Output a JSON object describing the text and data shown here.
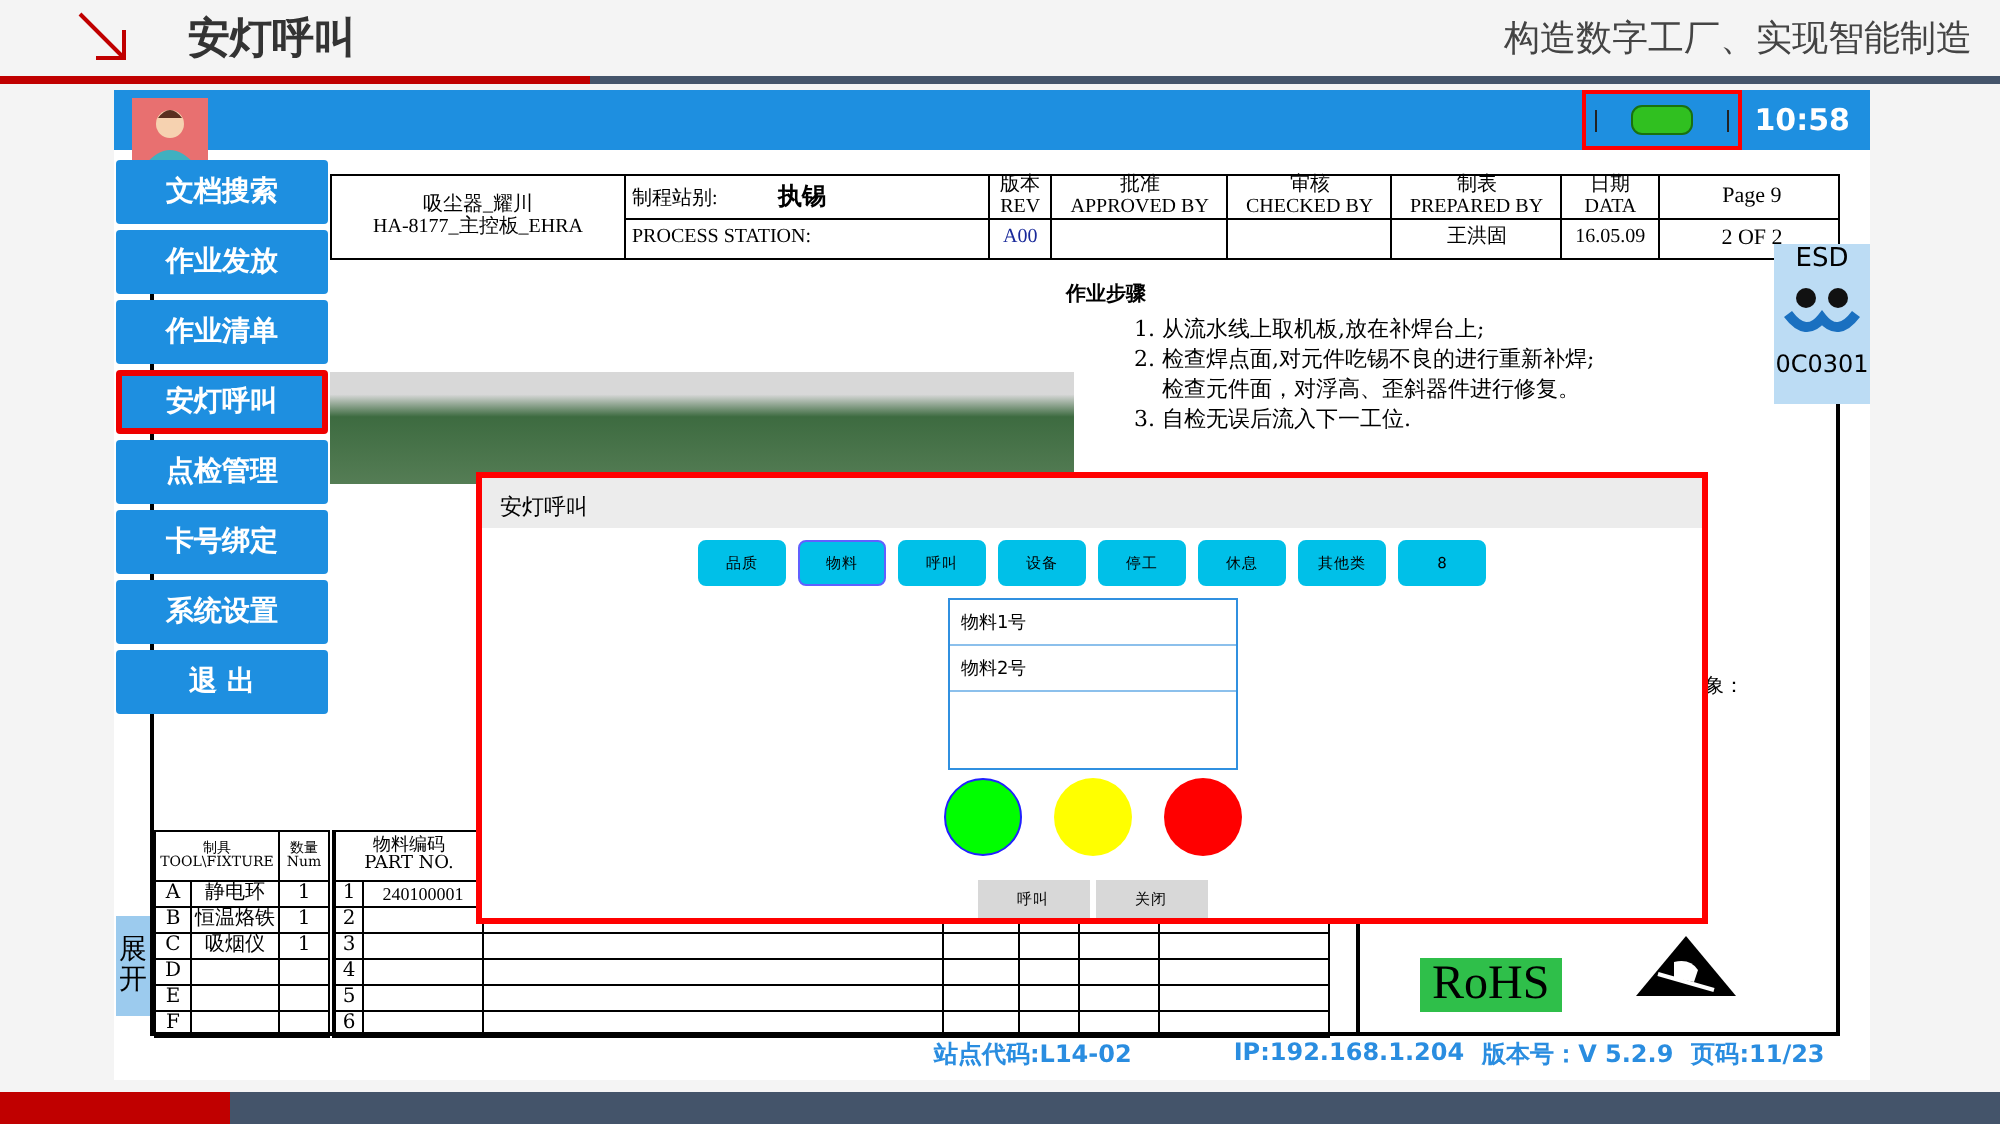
{
  "slide": {
    "title": "安灯呼叫",
    "slogan": "构造数字工厂、实现智能制造"
  },
  "top_bar": {
    "time": "10:58"
  },
  "menu": [
    {
      "label": "文档搜索",
      "selected": false
    },
    {
      "label": "作业发放",
      "selected": false
    },
    {
      "label": "作业清单",
      "selected": false
    },
    {
      "label": "安灯呼叫",
      "selected": true
    },
    {
      "label": "点检管理",
      "selected": false
    },
    {
      "label": "卡号绑定",
      "selected": false
    },
    {
      "label": "系统设置",
      "selected": false
    },
    {
      "label": "退 出",
      "selected": false
    }
  ],
  "sop_header": {
    "product": "吸尘器_耀川",
    "board": "HA-8177_主控板_EHRA",
    "station_label": "制程站别:",
    "station": "执锡",
    "station_label_en": "PROCESS STATION:",
    "columns": [
      {
        "cn": "版本",
        "en": "REV",
        "value": "A00"
      },
      {
        "cn": "批准",
        "en": "APPROVED BY"
      },
      {
        "cn": "审核",
        "en": "CHECKED BY"
      },
      {
        "cn": "制表",
        "en": "PREPARED BY",
        "value": "王洪固"
      },
      {
        "cn": "日期",
        "en": "DATA",
        "value": "16.05.09"
      }
    ],
    "page": "Page  9",
    "page_of": "2  OF  2"
  },
  "esd_badge": {
    "label": "ESD",
    "code": "0C0301"
  },
  "steps": {
    "title": "作业步骤",
    "lines": [
      {
        "kind": "item",
        "text": "1. 从流水线上取机板,放在补焊台上;"
      },
      {
        "kind": "item",
        "text": "2. 检查焊点面,对元件吃锡不良的进行重新补焊;"
      },
      {
        "kind": "continuation",
        "text": "检查元件面，对浮高、歪斜器件进行修复。"
      },
      {
        "kind": "item",
        "text": "3. 自检无误后流入下一工位."
      }
    ]
  },
  "side_note": "象：",
  "tools_table": {
    "columns": [
      {
        "cn": "制具",
        "en": "TOOL\\FIXTURE"
      },
      {
        "cn": "数量",
        "en": "Num"
      }
    ],
    "rows": [
      {
        "letter": "A",
        "name": "静电环",
        "num": "1"
      },
      {
        "letter": "B",
        "name": "恒温烙铁",
        "num": "1"
      },
      {
        "letter": "C",
        "name": "吸烟仪",
        "num": "1"
      },
      {
        "letter": "D"
      },
      {
        "letter": "E"
      },
      {
        "letter": "F"
      }
    ]
  },
  "parts_table": {
    "header_cn": "物料编码",
    "header_en": "PART  NO.",
    "rows": [
      {
        "index": "1",
        "code": "240100001"
      },
      {
        "index": "2"
      },
      {
        "index": "3"
      },
      {
        "index": "4"
      },
      {
        "index": "5"
      },
      {
        "index": "6"
      }
    ]
  },
  "expand_tab": "展开",
  "rohs": "RoHS",
  "status": {
    "station": "站点代码:L14-02",
    "ip": "IP:192.168.1.204",
    "version": "版本号：V 5.2.9",
    "page": "页码:11/23"
  },
  "dialog": {
    "title": "安灯呼叫",
    "categories": [
      {
        "label": "品质",
        "selected": false
      },
      {
        "label": "物料",
        "selected": true
      },
      {
        "label": "呼叫",
        "selected": false
      },
      {
        "label": "设备",
        "selected": false
      },
      {
        "label": "停工",
        "selected": false
      },
      {
        "label": "休息",
        "selected": false
      },
      {
        "label": "其他类",
        "selected": false
      },
      {
        "label": "8",
        "selected": false
      }
    ],
    "items": [
      "物料1号",
      "物料2号"
    ],
    "lights": [
      {
        "color": "#00ff00",
        "selected": true
      },
      {
        "color": "#ffff00",
        "selected": false
      },
      {
        "color": "#ff0000",
        "selected": false
      }
    ],
    "buttons": [
      "呼叫",
      "关闭"
    ]
  }
}
